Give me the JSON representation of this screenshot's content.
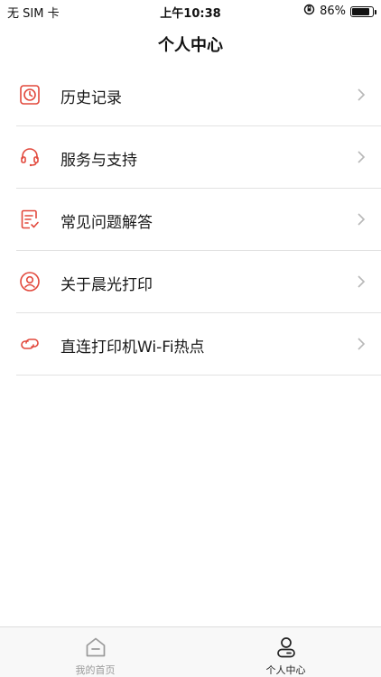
{
  "status_bar": {
    "carrier": "无 SIM 卡",
    "time": "上午10:38",
    "battery_percent": "86%",
    "battery_level": 0.86
  },
  "header": {
    "title": "个人中心"
  },
  "menu": {
    "items": [
      {
        "label": "历史记录",
        "icon": "clock-icon"
      },
      {
        "label": "服务与支持",
        "icon": "headset-icon"
      },
      {
        "label": "常见问题解答",
        "icon": "checklist-icon"
      },
      {
        "label": "关于晨光打印",
        "icon": "user-circle-icon"
      },
      {
        "label": "直连打印机Wi-Fi热点",
        "icon": "link-icon"
      }
    ]
  },
  "tab_bar": {
    "tabs": [
      {
        "label": "我的首页",
        "icon": "home-icon",
        "active": false
      },
      {
        "label": "个人中心",
        "icon": "person-icon",
        "active": true
      }
    ]
  },
  "colors": {
    "accent": "#e2483c",
    "divider": "#e2e2e2",
    "tab_inactive": "#9a9a9a"
  }
}
